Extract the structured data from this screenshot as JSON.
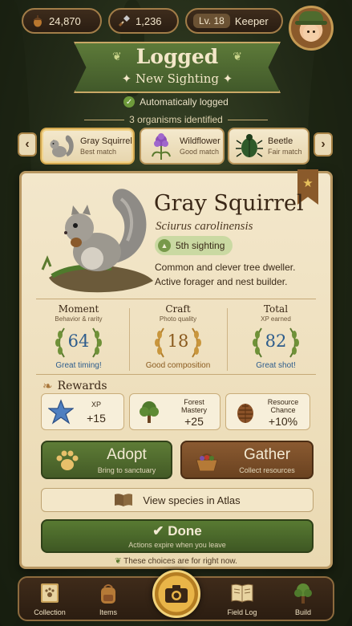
{
  "topbar": {
    "acorns": "24,870",
    "shovels": "1,236",
    "level_label": "Lv. 18",
    "rank": "Keeper",
    "icons": [
      "acorn-icon",
      "shovel-icon"
    ]
  },
  "banner": {
    "title": "Logged",
    "subtitle": "New Sighting"
  },
  "status": {
    "auto_logged": "Automatically logged",
    "identified": "3 organisms identified"
  },
  "carousel": [
    {
      "name": "Gray Squirrel",
      "match": "Best match",
      "icon": "squirrel-icon"
    },
    {
      "name": "Wildflower",
      "match": "Good match",
      "icon": "wildflower-icon"
    },
    {
      "name": "Beetle",
      "match": "Fair match",
      "icon": "beetle-icon"
    }
  ],
  "species": {
    "name": "Gray Squirrel",
    "scientific": "Sciurus carolinensis",
    "sighting": "5th sighting",
    "description_1": "Common and clever tree dweller.",
    "description_2": "Active forager and nest builder."
  },
  "stats": [
    {
      "label": "Moment",
      "sub": "Behavior & rarity",
      "value": "64",
      "caption": "Great timing!",
      "color": "#2d5c8c"
    },
    {
      "label": "Craft",
      "sub": "Photo quality",
      "value": "18",
      "caption": "Good composition",
      "color": "#8a5a1e"
    },
    {
      "label": "Total",
      "sub": "XP earned",
      "value": "82",
      "caption": "Great shot!",
      "color": "#2d5c8c"
    }
  ],
  "rewards": {
    "title": "Rewards",
    "items": [
      {
        "label": "XP",
        "value": "+15",
        "icon": "star-icon"
      },
      {
        "label": "Forest Mastery",
        "value": "+25",
        "icon": "tree-icon"
      },
      {
        "label": "Resource Chance",
        "value": "+10%",
        "icon": "pinecone-icon"
      }
    ]
  },
  "actions": {
    "adopt": {
      "title": "Adopt",
      "sub": "Bring to sanctuary"
    },
    "gather": {
      "title": "Gather",
      "sub": "Collect resources"
    },
    "atlas": "View species in Atlas",
    "done": {
      "title": "Done",
      "sub": "Actions expire when you leave"
    },
    "choices_note": "These choices are for right now."
  },
  "nav": [
    {
      "label": "Collection",
      "icon": "collection-book-icon"
    },
    {
      "label": "Items",
      "icon": "backpack-icon"
    },
    {
      "label": "Field Log",
      "icon": "field-log-book-icon"
    },
    {
      "label": "Build",
      "icon": "tree-build-icon"
    }
  ],
  "colors": {
    "accent_green": "#587a32",
    "accent_brown": "#7a4e28",
    "parchment": "#f3e7cb"
  }
}
